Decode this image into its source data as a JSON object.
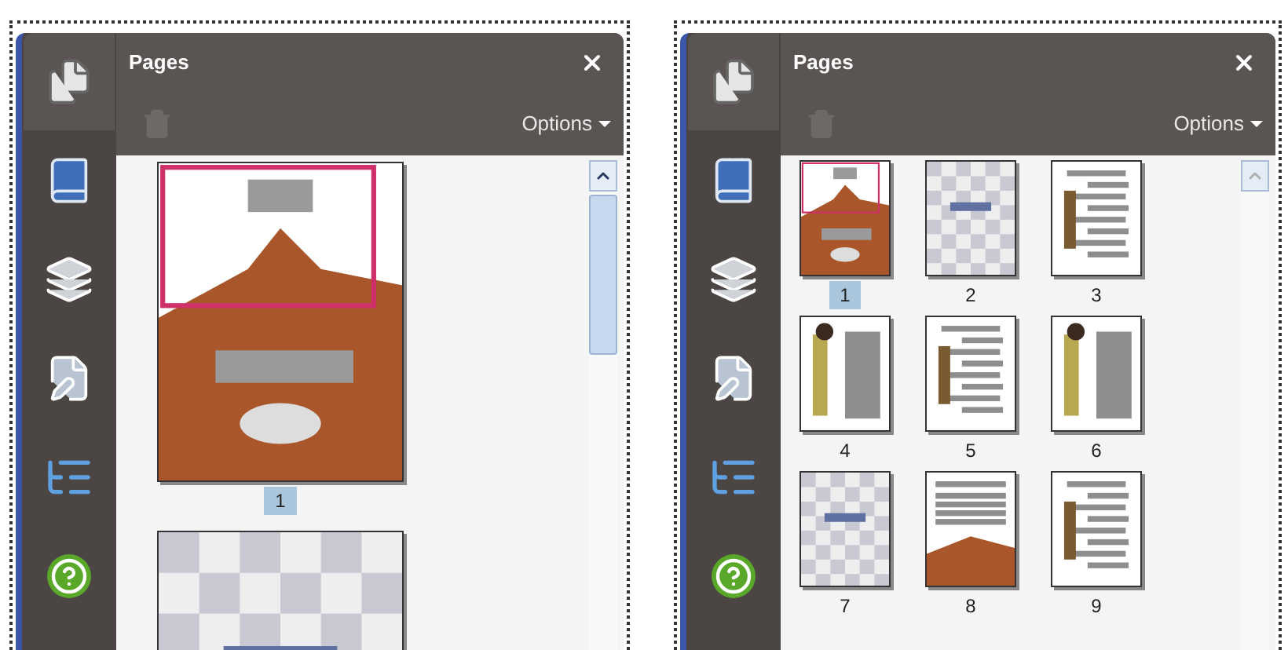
{
  "panels": [
    {
      "title": "Pages",
      "options_label": "Options",
      "kind": "large",
      "rail": [
        {
          "kind": "pages",
          "selected": true
        },
        {
          "kind": "bookmarks",
          "selected": false
        },
        {
          "kind": "layers",
          "selected": false
        },
        {
          "kind": "signatures",
          "selected": false
        },
        {
          "kind": "structure",
          "selected": false
        },
        {
          "kind": "help",
          "selected": false
        }
      ],
      "pages": [
        {
          "label": "1",
          "selected": true,
          "kind": "cover",
          "view_frame": true
        },
        {
          "kind": "checker"
        }
      ]
    },
    {
      "title": "Pages",
      "options_label": "Options",
      "kind": "small",
      "rail": [
        {
          "kind": "pages",
          "selected": true
        },
        {
          "kind": "bookmarks",
          "selected": false
        },
        {
          "kind": "layers",
          "selected": false
        },
        {
          "kind": "signatures",
          "selected": false
        },
        {
          "kind": "structure",
          "selected": false
        },
        {
          "kind": "help",
          "selected": false
        }
      ],
      "pages": [
        {
          "label": "1",
          "selected": true,
          "kind": "cover",
          "view_frame": true
        },
        {
          "label": "2",
          "selected": false,
          "kind": "checker",
          "view_frame": false
        },
        {
          "label": "3",
          "selected": false,
          "kind": "text",
          "view_frame": false
        },
        {
          "label": "4",
          "selected": false,
          "kind": "illustrated",
          "view_frame": false
        },
        {
          "label": "5",
          "selected": false,
          "kind": "text",
          "view_frame": false
        },
        {
          "label": "6",
          "selected": false,
          "kind": "illustrated",
          "view_frame": false
        },
        {
          "label": "7",
          "selected": false,
          "kind": "checker",
          "view_frame": false
        },
        {
          "label": "8",
          "selected": false,
          "kind": "landscape",
          "view_frame": false
        },
        {
          "label": "9",
          "selected": false,
          "kind": "text",
          "view_frame": false
        }
      ]
    }
  ]
}
